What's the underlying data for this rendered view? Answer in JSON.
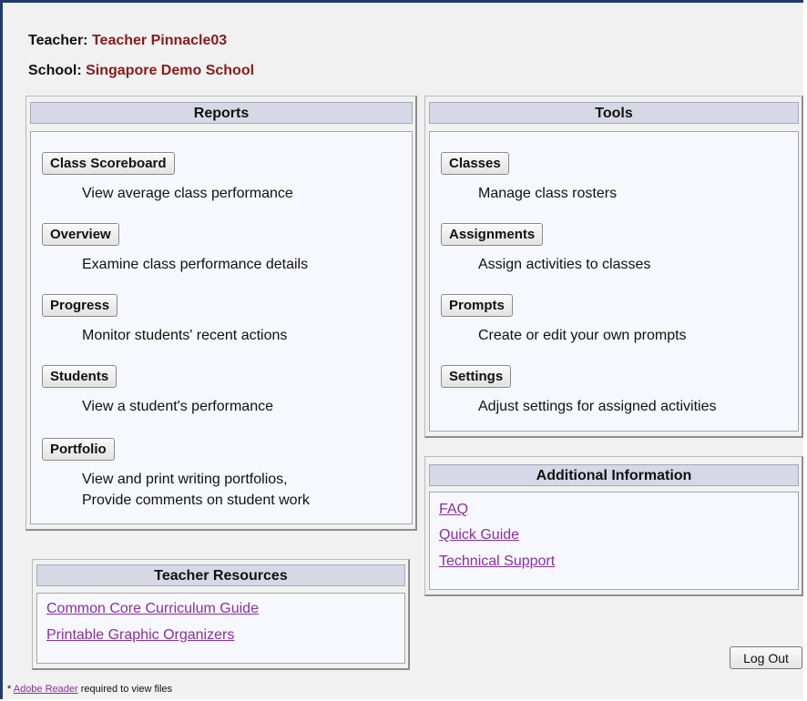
{
  "header": {
    "teacher_label": "Teacher:",
    "teacher_name": "Teacher Pinnacle03",
    "school_label": "School:",
    "school_name": "Singapore Demo School"
  },
  "reports": {
    "title": "Reports",
    "items": [
      {
        "label": "Class Scoreboard",
        "desc": "View average class performance"
      },
      {
        "label": "Overview",
        "desc": "Examine class performance details"
      },
      {
        "label": "Progress",
        "desc": "Monitor students' recent actions"
      },
      {
        "label": "Students",
        "desc": "View a student's performance"
      },
      {
        "label": "Portfolio",
        "desc": "View and print writing portfolios,",
        "desc2": "Provide comments on student work"
      }
    ]
  },
  "tools": {
    "title": "Tools",
    "items": [
      {
        "label": "Classes",
        "desc": "Manage class rosters"
      },
      {
        "label": "Assignments",
        "desc": "Assign activities to classes"
      },
      {
        "label": "Prompts",
        "desc": "Create or edit your own prompts"
      },
      {
        "label": "Settings",
        "desc": "Adjust settings for assigned activities"
      }
    ]
  },
  "additional": {
    "title": "Additional Information",
    "links": [
      "FAQ",
      "Quick Guide",
      "Technical Support"
    ]
  },
  "resources": {
    "title": "Teacher Resources",
    "links": [
      "Common Core Curriculum Guide",
      "Printable Graphic Organizers"
    ]
  },
  "logout_label": "Log Out",
  "footnote": {
    "prefix": "* ",
    "link": "Adobe Reader",
    "suffix": " required to view files"
  },
  "colors": {
    "name_color": "#8b1a1a",
    "link_color": "#8b2fa0",
    "header_bg": "#d6d8e6",
    "frame_border": "#1f3b6e"
  }
}
